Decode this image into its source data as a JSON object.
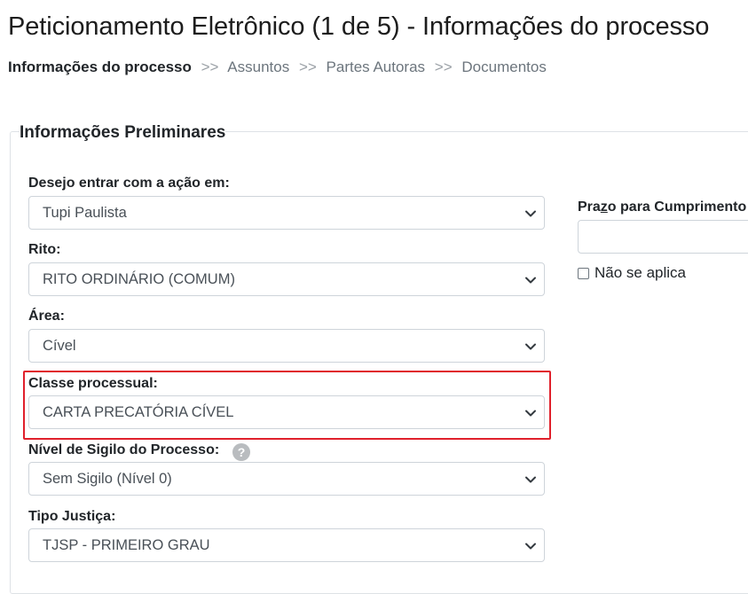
{
  "page": {
    "title": "Peticionamento Eletrônico (1 de 5) - Informações do processo"
  },
  "breadcrumb": {
    "items": [
      "Informações do processo",
      "Assuntos",
      "Partes Autoras",
      "Documentos"
    ],
    "separator": ">>"
  },
  "section": {
    "legend": "Informações Preliminares"
  },
  "fields": {
    "comarca": {
      "label": "Desejo entrar com a ação em:",
      "value": "Tupi Paulista"
    },
    "rito": {
      "label": "Rito:",
      "value": "RITO ORDINÁRIO (COMUM)"
    },
    "area": {
      "label": "Área:",
      "value": "Cível"
    },
    "classe": {
      "label": "Classe processual:",
      "value": "CARTA PRECATÓRIA CÍVEL"
    },
    "sigilo": {
      "label": "Nível de Sigilo do Processo:",
      "value": "Sem Sigilo (Nível 0)",
      "help": "?"
    },
    "justica": {
      "label": "Tipo Justiça:",
      "value": "TJSP - PRIMEIRO GRAU"
    }
  },
  "prazo": {
    "label_before": "Pra",
    "label_underlined": "z",
    "label_after": "o para Cumprimento",
    "value": "",
    "checkbox_label": "Não se aplica",
    "checkbox_checked": false
  },
  "colors": {
    "highlight": "#e0202c",
    "border": "#ced4da",
    "text": "#212529",
    "muted": "#6c757d"
  }
}
